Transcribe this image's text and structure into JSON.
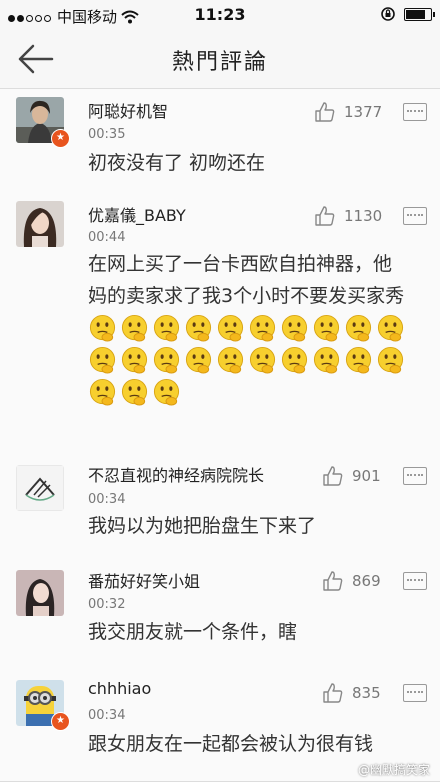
{
  "status_bar": {
    "carrier": "中国移动",
    "time": "11:23"
  },
  "header": {
    "title": "熱門評論"
  },
  "comments": [
    {
      "username": "阿聪好机智",
      "time": "00:35",
      "likes": "1377",
      "text": "初夜没有了 初吻还在"
    },
    {
      "username": "优嘉儀_BABY",
      "time": "00:44",
      "likes": "1130",
      "text": "在网上买了一台卡西欧自拍神器，他妈的卖家求了我3个小时不要发买家秀"
    },
    {
      "username": "不忍直视的神经病院院长",
      "time": "00:34",
      "likes": "901",
      "text": "我妈以为她把胎盘生下来了"
    },
    {
      "username": "番茄好好笑小姐",
      "time": "00:32",
      "likes": "869",
      "text": "我交朋友就一个条件，瞎"
    },
    {
      "username": "chhhiao",
      "time": "00:34",
      "likes": "835",
      "text": "跟女朋友在一起都会被认为很有钱"
    }
  ],
  "watermark": "@幽默搞笑家"
}
